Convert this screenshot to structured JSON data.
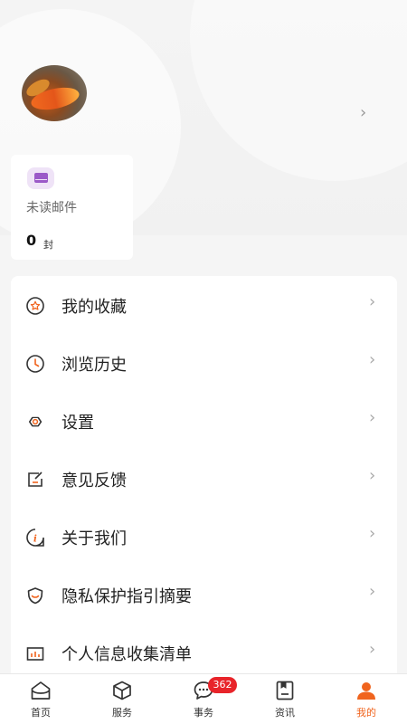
{
  "profile": {
    "arrow": "›"
  },
  "mail": {
    "label": "未读邮件",
    "count": "0",
    "unit": "封",
    "icon": "envelope-icon",
    "accent": "#9b59c8"
  },
  "menu": {
    "items": [
      {
        "label": "我的收藏",
        "icon": "star-badge-icon",
        "arrow": "›"
      },
      {
        "label": "浏览历史",
        "icon": "clock-icon",
        "arrow": "›"
      },
      {
        "label": "设置",
        "icon": "gear-hex-icon",
        "arrow": "›"
      },
      {
        "label": "意见反馈",
        "icon": "feedback-icon",
        "arrow": "›"
      },
      {
        "label": "关于我们",
        "icon": "info-icon",
        "arrow": "›"
      },
      {
        "label": "隐私保护指引摘要",
        "icon": "shield-icon",
        "arrow": "›"
      },
      {
        "label": "个人信息收集清单",
        "icon": "chart-list-icon",
        "arrow": "›"
      }
    ]
  },
  "tabbar": {
    "active_color": "#f0641e",
    "tabs": [
      {
        "label": "首页",
        "icon": "home-icon"
      },
      {
        "label": "服务",
        "icon": "cube-icon"
      },
      {
        "label": "事务",
        "icon": "chat-icon",
        "badge": "362"
      },
      {
        "label": "资讯",
        "icon": "news-icon"
      },
      {
        "label": "我的",
        "icon": "person-icon",
        "active": true
      }
    ]
  }
}
